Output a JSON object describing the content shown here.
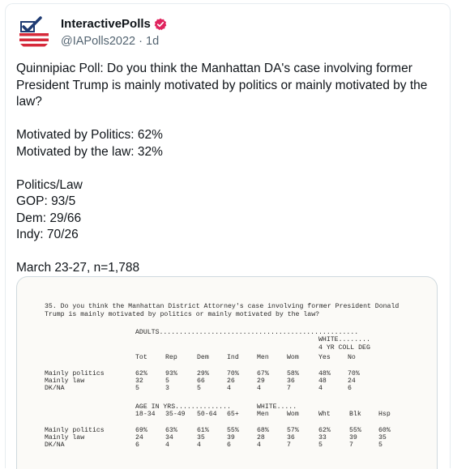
{
  "author": {
    "display_name": "InteractivePolls",
    "handle": "@IAPolls2022",
    "separator": "·",
    "time": "1d"
  },
  "tweet": {
    "text": "Quinnipiac Poll: Do you think the Manhattan DA's case involving former President Trump is mainly motivated by politics or mainly motivated by the law?\n\nMotivated by Politics: 62%\nMotivated by the law: 32%\n\nPolitics/Law\nGOP: 93/5\nDem: 29/66\nIndy: 70/26\n\nMarch 23-27, n=1,788"
  },
  "poll_image": {
    "question_line1": "35. Do you think the Manhattan District Attorney's case involving former President Donald",
    "question_line2": "Trump is mainly motivated by politics or mainly motivated by the law?",
    "group1_header": "ADULTS..................................................",
    "group1_white_header": "WHITE........",
    "group1_white_sub": "4 YR COLL DEG",
    "group1_columns": [
      "Tot",
      "Rep",
      "Dem",
      "Ind",
      "Men",
      "Wom",
      "Yes",
      "No"
    ],
    "row_labels": [
      "Mainly politics",
      "Mainly law",
      "DK/NA"
    ],
    "group1_rows": [
      [
        "62%",
        "93%",
        "29%",
        "70%",
        "67%",
        "58%",
        "48%",
        "70%"
      ],
      [
        "32",
        "5",
        "66",
        "26",
        "29",
        "36",
        "48",
        "24"
      ],
      [
        "5",
        "3",
        "5",
        "4",
        "4",
        "7",
        "4",
        "6"
      ]
    ],
    "group2_age_header": "AGE IN YRS..............",
    "group2_white_header": "WHITE.....",
    "group2_columns": [
      "18-34",
      "35-49",
      "50-64",
      "65+",
      "Men",
      "Wom",
      "Wht",
      "Blk",
      "Hsp"
    ],
    "group2_rows": [
      [
        "69%",
        "63%",
        "61%",
        "55%",
        "68%",
        "57%",
        "62%",
        "55%",
        "60%"
      ],
      [
        "24",
        "34",
        "35",
        "39",
        "28",
        "36",
        "33",
        "39",
        "35"
      ],
      [
        "6",
        "4",
        "4",
        "6",
        "4",
        "7",
        "5",
        "7",
        "5"
      ]
    ]
  },
  "colors": {
    "verified_badge": "#e0245e",
    "avatar_red": "#d6293a",
    "avatar_blue": "#1f3b73",
    "handle_gray": "#536471"
  }
}
